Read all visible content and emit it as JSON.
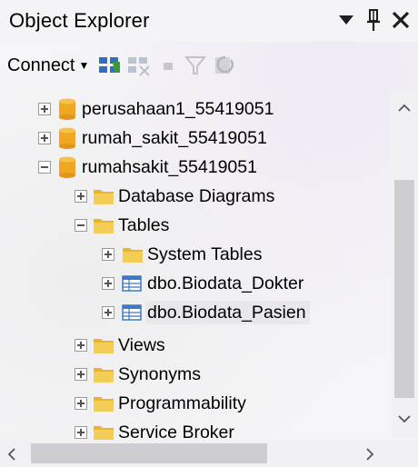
{
  "panel": {
    "title": "Object Explorer"
  },
  "toolbar": {
    "connect_label": "Connect"
  },
  "tree": {
    "items": [
      {
        "label": "perusahaan1_55419051",
        "expander": "plus",
        "icon": "database-icon"
      },
      {
        "label": "rumah_sakit_55419051",
        "expander": "plus",
        "icon": "database-icon"
      },
      {
        "label": "rumahsakit_55419051",
        "expander": "minus",
        "icon": "database-icon"
      },
      {
        "label": "Database Diagrams",
        "expander": "plus",
        "icon": "folder-icon"
      },
      {
        "label": "Tables",
        "expander": "minus",
        "icon": "folder-icon"
      },
      {
        "label": "System Tables",
        "expander": "plus",
        "icon": "folder-icon"
      },
      {
        "label": "dbo.Biodata_Dokter",
        "expander": "plus",
        "icon": "table-icon"
      },
      {
        "label": "dbo.Biodata_Pasien",
        "expander": "plus",
        "icon": "table-icon",
        "selected": true
      },
      {
        "label": "Views",
        "expander": "plus",
        "icon": "folder-icon"
      },
      {
        "label": "Synonyms",
        "expander": "plus",
        "icon": "folder-icon"
      },
      {
        "label": "Programmability",
        "expander": "plus",
        "icon": "folder-icon"
      },
      {
        "label": "Service Broker",
        "expander": "plus",
        "icon": "folder-icon"
      }
    ]
  },
  "colors": {
    "database": "#f0a823",
    "folder": "#f2c64b",
    "table": "#3a78c8",
    "selection": "#e8e8ec"
  }
}
